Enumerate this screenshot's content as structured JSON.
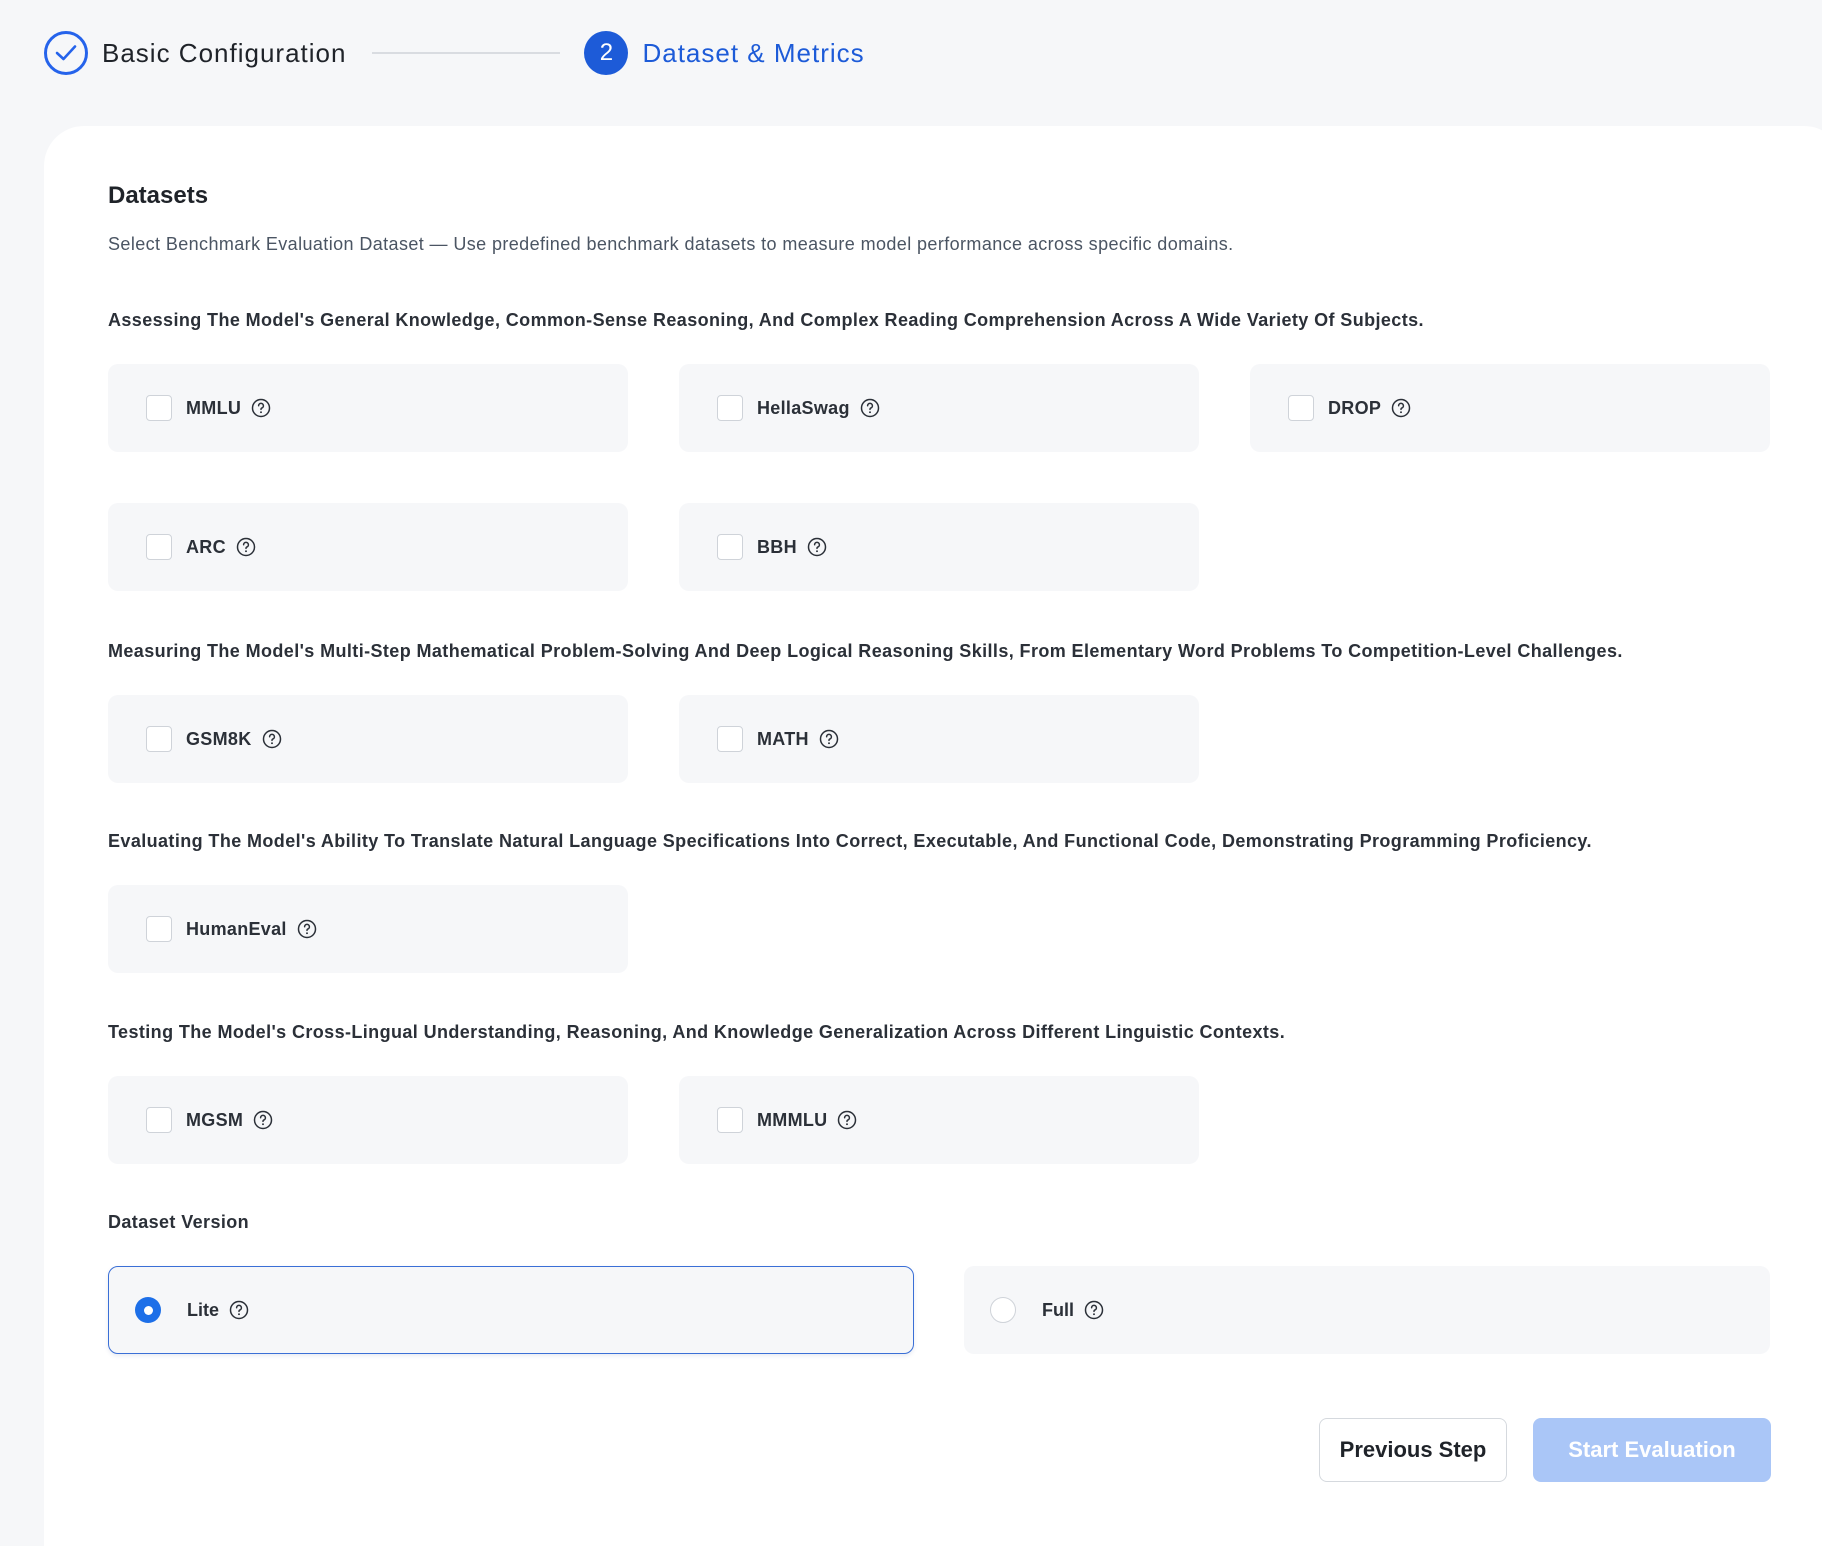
{
  "stepper": {
    "step1_title": "Basic Configuration",
    "step2_number": "2",
    "step2_title": "Dataset & Metrics"
  },
  "datasets": {
    "title": "Datasets",
    "description": "Select Benchmark Evaluation Dataset — Use predefined benchmark datasets to measure model performance across specific domains.",
    "groups": [
      {
        "label": "Assessing The Model's General Knowledge, Common-Sense Reasoning, And Complex Reading Comprehension Across A Wide Variety Of Subjects.",
        "options": [
          "MMLU",
          "HellaSwag",
          "DROP",
          "ARC",
          "BBH"
        ]
      },
      {
        "label": "Measuring The Model's Multi-Step Mathematical Problem-Solving And Deep Logical Reasoning Skills, From Elementary Word Problems To Competition-Level Challenges.",
        "options": [
          "GSM8K",
          "MATH"
        ]
      },
      {
        "label": "Evaluating The Model's Ability To Translate Natural Language Specifications Into Correct, Executable, And Functional Code, Demonstrating Programming Proficiency.",
        "options": [
          "HumanEval"
        ]
      },
      {
        "label": "Testing The Model's Cross-Lingual Understanding, Reasoning, And Knowledge Generalization Across Different Linguistic Contexts.",
        "options": [
          "MGSM",
          "MMMLU"
        ]
      }
    ]
  },
  "version": {
    "label": "Dataset Version",
    "options": [
      "Lite",
      "Full"
    ],
    "selected": "Lite"
  },
  "buttons": {
    "previous": "Previous Step",
    "start": "Start Evaluation"
  },
  "colors": {
    "accent": "#1d5bd8",
    "radio_selected": "#1d6fe8",
    "start_disabled": "#aac6f7",
    "option_bg": "#f6f7f9"
  },
  "icons": {
    "step_done": "check-circle-icon",
    "help": "question-circle-icon"
  }
}
